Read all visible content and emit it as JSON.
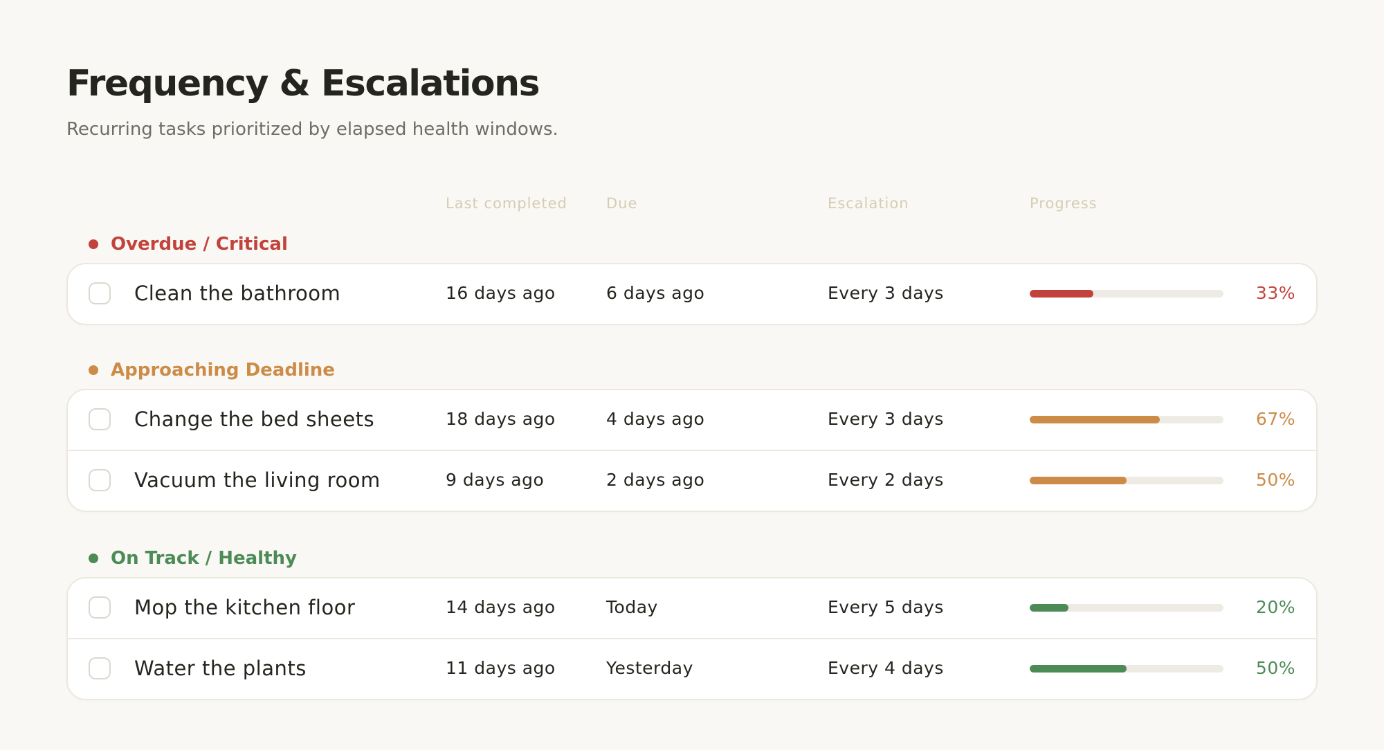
{
  "page": {
    "title": "Frequency & Escalations",
    "subtitle": "Recurring tasks prioritized by elapsed health windows."
  },
  "columns": {
    "last_completed": "Last completed",
    "due": "Due",
    "escalation": "Escalation",
    "progress": "Progress"
  },
  "colors": {
    "critical": "#c2433c",
    "approaching": "#cd8b48",
    "healthy": "#4d8b56",
    "track": "#eeebe4"
  },
  "groups": [
    {
      "label": "Overdue / Critical",
      "color": "#c2433c",
      "tasks": [
        {
          "name": "Clean the bathroom",
          "last_completed": "16 days ago",
          "due": "6 days ago",
          "escalation": "Every 3 days",
          "progress": 33,
          "progress_label": "33%"
        }
      ]
    },
    {
      "label": "Approaching Deadline",
      "color": "#cd8b48",
      "tasks": [
        {
          "name": "Change the bed sheets",
          "last_completed": "18 days ago",
          "due": "4 days ago",
          "escalation": "Every 3 days",
          "progress": 67,
          "progress_label": "67%"
        },
        {
          "name": "Vacuum the living room",
          "last_completed": "9 days ago",
          "due": "2 days ago",
          "escalation": "Every 2 days",
          "progress": 50,
          "progress_label": "50%"
        }
      ]
    },
    {
      "label": "On Track / Healthy",
      "color": "#4d8b56",
      "tasks": [
        {
          "name": "Mop the kitchen floor",
          "last_completed": "14 days ago",
          "due": "Today",
          "escalation": "Every 5 days",
          "progress": 20,
          "progress_label": "20%"
        },
        {
          "name": "Water the plants",
          "last_completed": "11 days ago",
          "due": "Yesterday",
          "escalation": "Every 4 days",
          "progress": 50,
          "progress_label": "50%"
        }
      ]
    }
  ]
}
